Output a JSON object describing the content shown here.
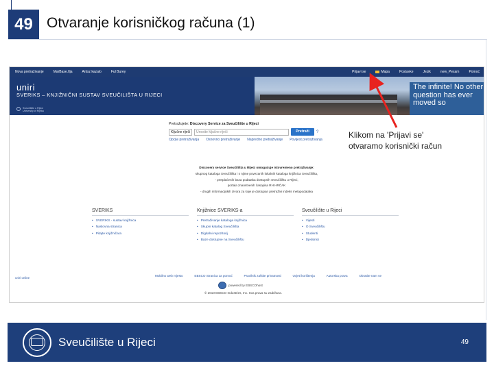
{
  "slide": {
    "number": "49",
    "title": "Otvaranje korisničkog računa (1)",
    "page_number": "49",
    "university": "Sveučilište u Rijeci"
  },
  "screenshot": {
    "topnav_left": [
      "Nova pretraživanje",
      "MarBase.Ilja",
      "Antsz kazalo",
      "Ful Burey"
    ],
    "topnav_right": [
      "Prijavi se",
      "Mapa",
      "Postavke",
      "Jezik",
      "new_Pexam",
      "Pomoć"
    ],
    "banner": {
      "logo_text": "uniri",
      "subtitle": "SVERIKS – KNJIŽNIČNI SUSTAV SVEUČILIŠTA U RIJECI",
      "logo_caption_1": "Sveučilište u Rijeci",
      "logo_caption_2": "University of Rijeka",
      "quote": "The infinite! No other question has ever moved so"
    },
    "search": {
      "heading_prefix": "Pretražujete:",
      "heading_bold": "Discovery Service za Sveučilište u Rijeci",
      "select_value": "Ključne riječi",
      "input_placeholder": "Unesite ključne riječi",
      "button_label": "Pretraži",
      "help": "?",
      "options": [
        "Opcije pretraživanja",
        "Osnovno pretraživanje",
        "Napredno pretraživanje",
        "Povijest pretraživanja"
      ]
    },
    "description": {
      "heading": "Discovery service Sveučilišta u Rijeci omogućuje istovremeno pretraživanje:",
      "lines": [
        "skupnog kataloga Sveučilišta i s njime povezanih lokalnih kataloga knjižnica Sveučilišta,",
        "- pretplaćenih baza podataka dostupnih Sveučilištu u Rijeci,",
        "portala znanstvenih časopisa RH HRČAK",
        "- drugih informacijskih izvora za koje je dostupan pretraživi indeks metapodataka"
      ]
    },
    "columns": [
      {
        "heading": "SVERIKS",
        "items": [
          "SVERIKS - sustav knjižnica",
          "Naslovna stranica",
          "Pitajte knjižničara"
        ]
      },
      {
        "heading": "Knjižnice SVERIKS-a",
        "items": [
          "Pretraživanje kataloga knjižnica",
          "Skupni katalog Sveučilišta",
          "Digitalni repozitorij",
          "Baze dostupne na Sveučilištu"
        ]
      },
      {
        "heading": "Sveučilište u Rijeci",
        "items": [
          "Vijesti",
          "O Sveučilištu",
          "Studenti",
          "Djelatnici"
        ]
      }
    ],
    "footer": {
      "left": "uniri online",
      "links": [
        "Mobilno web mjesto",
        "EBSCO Stranica za pomoć",
        "Pravilnik zaštite privatnosti",
        "Uvjeti korištenja",
        "Autorska prava",
        "Obratite nam se"
      ],
      "powered": "powered by EBSCOhost",
      "copyright": "© 2010 EBSCO Industries, Inc. Sva prava su zadržana."
    }
  },
  "annotation": {
    "line1": "Klikom na 'Prijavi se'",
    "line2": "otvaramo korisnički račun",
    "arrow_color": "#e8231f"
  },
  "colors": {
    "navy": "#1d3c78",
    "accent_blue": "#2a73c9"
  }
}
